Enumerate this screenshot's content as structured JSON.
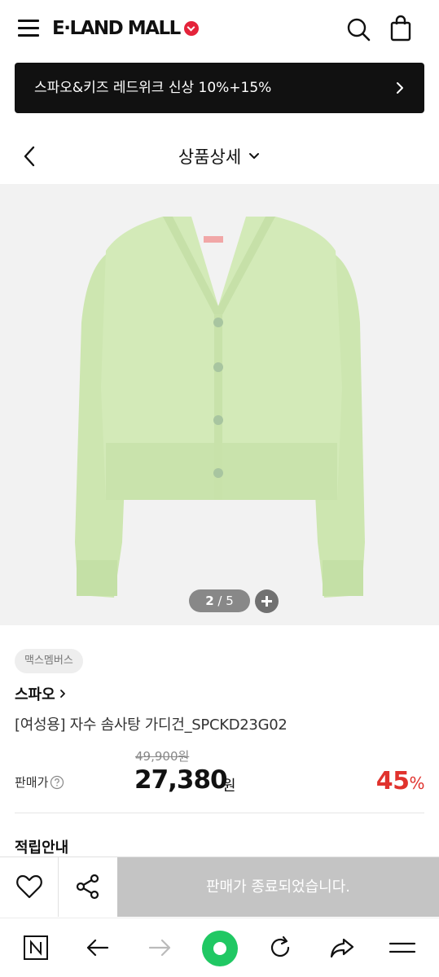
{
  "header": {
    "logo": "E·LAND MALL",
    "menu_icon": "hamburger-menu-icon",
    "search_icon": "search-icon",
    "cart_icon": "shopping-bag-icon"
  },
  "promo": {
    "text": "스파오&키즈 레드위크 신상 10%+15%",
    "arrow_icon": "chevron-right-icon"
  },
  "titlebar": {
    "title": "상품상세",
    "back_icon": "chevron-left-icon",
    "dropdown_icon": "chevron-down-icon"
  },
  "gallery": {
    "current": "2",
    "separator": "/",
    "total": "5",
    "zoom_icon": "plus-icon",
    "product_color": "#cfe8b4"
  },
  "product": {
    "tag": "맥스멤버스",
    "brand": "스파오",
    "name": "[여성용] 자수 솜사탕 가디건_SPCKD23G02",
    "original_price": "49,900원",
    "price_label": "판매가",
    "price": "27,380",
    "price_unit": "원",
    "discount": "45",
    "discount_unit": "%"
  },
  "points_section": {
    "title": "적립안내"
  },
  "action_bar": {
    "wish_icon": "heart-icon",
    "share_icon": "share-icon",
    "soldout_label": "판매가 종료되었습니다."
  },
  "browser_bar": {
    "items": [
      "naver-n-icon",
      "back-arrow-icon",
      "forward-arrow-icon",
      "home-icon",
      "refresh-icon",
      "share-arrow-icon",
      "menu-icon"
    ]
  },
  "colors": {
    "accent_red": "#e0322d",
    "home_green": "#20c863",
    "soldout_gray": "#c4c4c4"
  }
}
